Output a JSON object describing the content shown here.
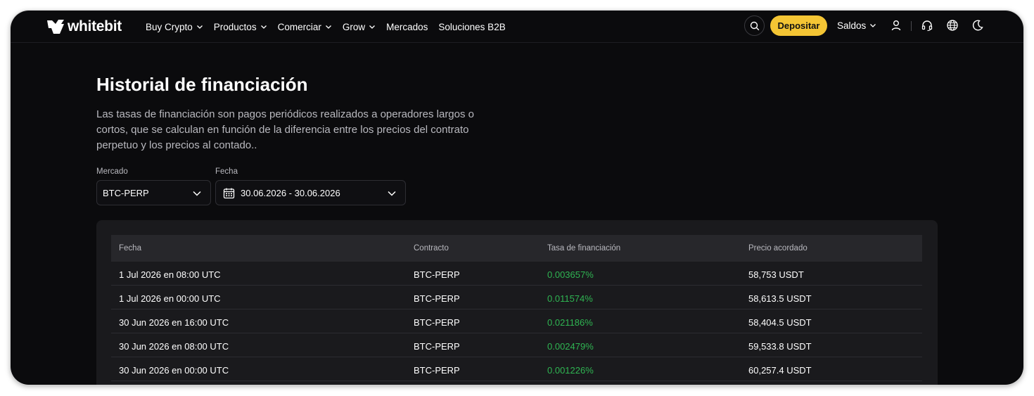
{
  "brand": {
    "name": "whitebit"
  },
  "nav": [
    {
      "label": "Buy Crypto",
      "dropdown": true
    },
    {
      "label": "Productos",
      "dropdown": true
    },
    {
      "label": "Comerciar",
      "dropdown": true
    },
    {
      "label": "Grow",
      "dropdown": true
    },
    {
      "label": "Mercados",
      "dropdown": false
    },
    {
      "label": "Soluciones B2B",
      "dropdown": false
    }
  ],
  "header": {
    "deposit_label": "Depositar",
    "balances_label": "Saldos",
    "accent_color": "#f4c534",
    "icons": [
      "search-icon",
      "user-icon",
      "headset-icon",
      "globe-icon",
      "moon-icon"
    ]
  },
  "page": {
    "title": "Historial de financiación",
    "description": "Las tasas de financiación son pagos periódicos realizados a operadores largos o cortos, que se calculan en función de la diferencia entre los precios del contrato perpetuo y los precios al contado.."
  },
  "filters": {
    "market": {
      "label": "Mercado",
      "value": "BTC-PERP"
    },
    "date": {
      "label": "Fecha",
      "value": "30.06.2026 - 30.06.2026"
    }
  },
  "table": {
    "columns": [
      "Fecha",
      "Contracto",
      "Tasa de financiación",
      "Precio acordado"
    ],
    "rows": [
      {
        "date": "1 Jul 2026 en 08:00 UTC",
        "contract": "BTC-PERP",
        "rate": "0.003657%",
        "price": "58,753 USDT"
      },
      {
        "date": "1 Jul 2026 en 00:00 UTC",
        "contract": "BTC-PERP",
        "rate": "0.011574%",
        "price": "58,613.5 USDT"
      },
      {
        "date": "30 Jun 2026 en 16:00 UTC",
        "contract": "BTC-PERP",
        "rate": "0.021186%",
        "price": "58,404.5 USDT"
      },
      {
        "date": "30 Jun 2026 en 08:00 UTC",
        "contract": "BTC-PERP",
        "rate": "0.002479%",
        "price": "59,533.8 USDT"
      },
      {
        "date": "30 Jun 2026 en 00:00 UTC",
        "contract": "BTC-PERP",
        "rate": "0.001226%",
        "price": "60,257.4 USDT"
      }
    ],
    "rate_color": "#2fb552"
  }
}
